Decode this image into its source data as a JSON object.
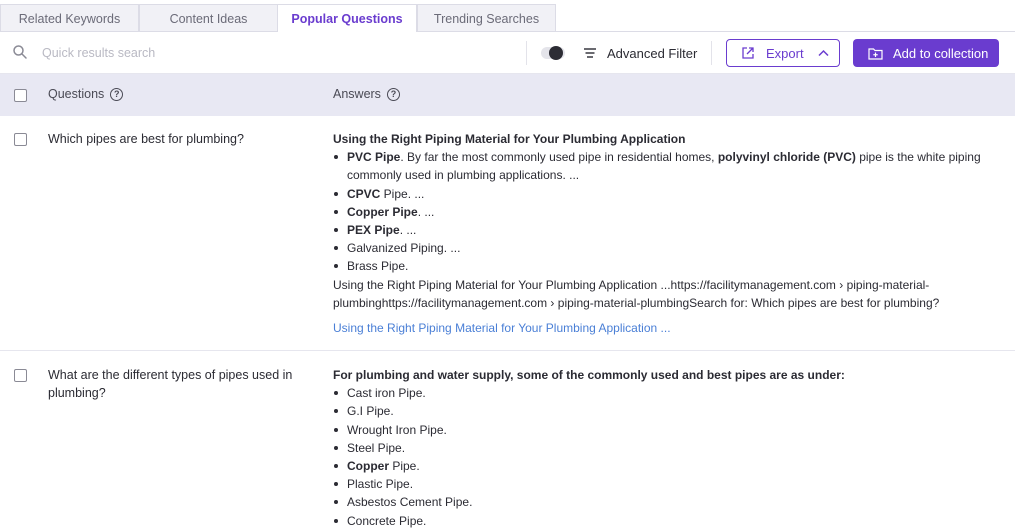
{
  "tabs": [
    {
      "label": "Related Keywords",
      "active": false
    },
    {
      "label": "Content Ideas",
      "active": false
    },
    {
      "label": "Popular Questions",
      "active": true
    },
    {
      "label": "Trending Searches",
      "active": false
    }
  ],
  "toolbar": {
    "search_placeholder": "Quick results search",
    "advanced_filter_label": "Advanced Filter",
    "export_label": "Export",
    "add_collection_label": "Add to collection"
  },
  "table": {
    "col_questions": "Questions",
    "col_answers": "Answers"
  },
  "rows": [
    {
      "question": "Which pipes are best for plumbing?",
      "answer_heading": "Using the Right Piping Material for Your Plumbing Application",
      "items": [
        {
          "bold": "PVC Pipe",
          "text": ". By far the most commonly used pipe in residential homes, ",
          "bold2": "polyvinyl chloride (PVC)",
          "text2": " pipe is the white piping commonly used in plumbing applications. ..."
        },
        {
          "bold": "CPVC",
          "text": " Pipe. ..."
        },
        {
          "bold": "Copper Pipe",
          "text": ". ..."
        },
        {
          "bold": "PEX Pipe",
          "text": ". ..."
        },
        {
          "bold": "",
          "text": "Galvanized Piping. ..."
        },
        {
          "bold": "",
          "text": "Brass Pipe."
        }
      ],
      "source_text": "Using the Right Piping Material for Your Plumbing Application ...https://facilitymanagement.com › piping-material-plumbinghttps://facilitymanagement.com › piping-material-plumbingSearch for: Which pipes are best for plumbing?",
      "link": "Using the Right Piping Material for Your Plumbing Application ..."
    },
    {
      "question": "What are the different types of pipes used in plumbing?",
      "answer_heading": "For plumbing and water supply, some of the commonly used and best pipes are as under:",
      "items": [
        {
          "bold": "",
          "text": "Cast iron Pipe."
        },
        {
          "bold": "",
          "text": "G.I Pipe."
        },
        {
          "bold": "",
          "text": "Wrought Iron Pipe."
        },
        {
          "bold": "",
          "text": "Steel Pipe."
        },
        {
          "bold": "Copper",
          "text": " Pipe."
        },
        {
          "bold": "",
          "text": "Plastic Pipe."
        },
        {
          "bold": "",
          "text": "Asbestos Cement Pipe."
        },
        {
          "bold": "",
          "text": "Concrete Pipe."
        }
      ]
    }
  ],
  "colors": {
    "accent": "#6a3ccf",
    "link": "#4a7fd6",
    "header_bg": "#e8e8f3"
  }
}
